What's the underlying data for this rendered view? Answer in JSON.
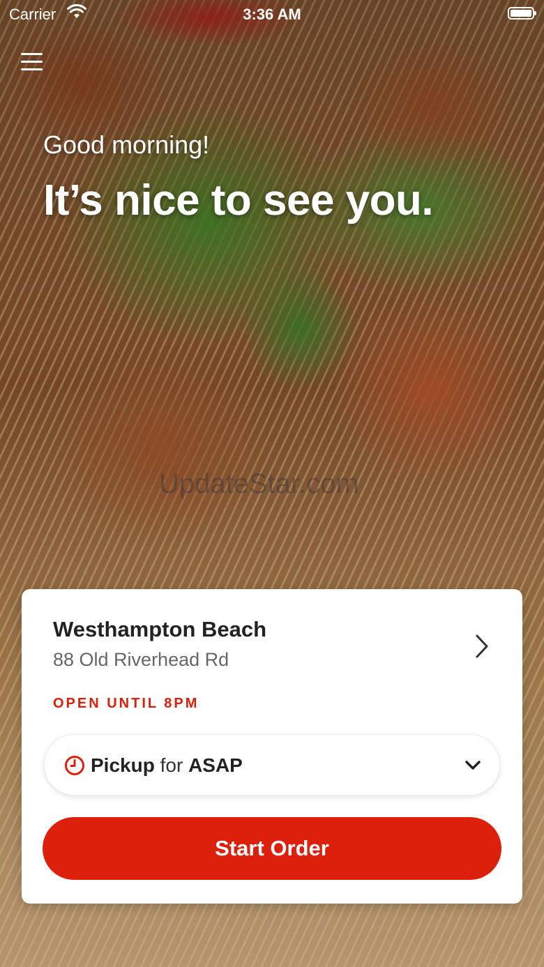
{
  "status_bar": {
    "carrier": "Carrier",
    "time": "3:36 AM"
  },
  "hero": {
    "greeting": "Good morning!",
    "headline": "It’s nice to see you.",
    "watermark": "UpdateStar.com"
  },
  "location": {
    "name": "Westhampton Beach",
    "address": "88 Old Riverhead Rd",
    "status": "OPEN UNTIL 8PM"
  },
  "order_options": {
    "mode": "Pickup",
    "connector": "for",
    "time": "ASAP"
  },
  "actions": {
    "start_order": "Start Order"
  },
  "colors": {
    "accent": "#dd200b",
    "text_dark": "#222222",
    "text_muted": "#666666"
  },
  "icons": [
    "menu-icon",
    "wifi-icon",
    "battery-icon",
    "chevron-right-icon",
    "clock-icon",
    "chevron-down-icon"
  ]
}
